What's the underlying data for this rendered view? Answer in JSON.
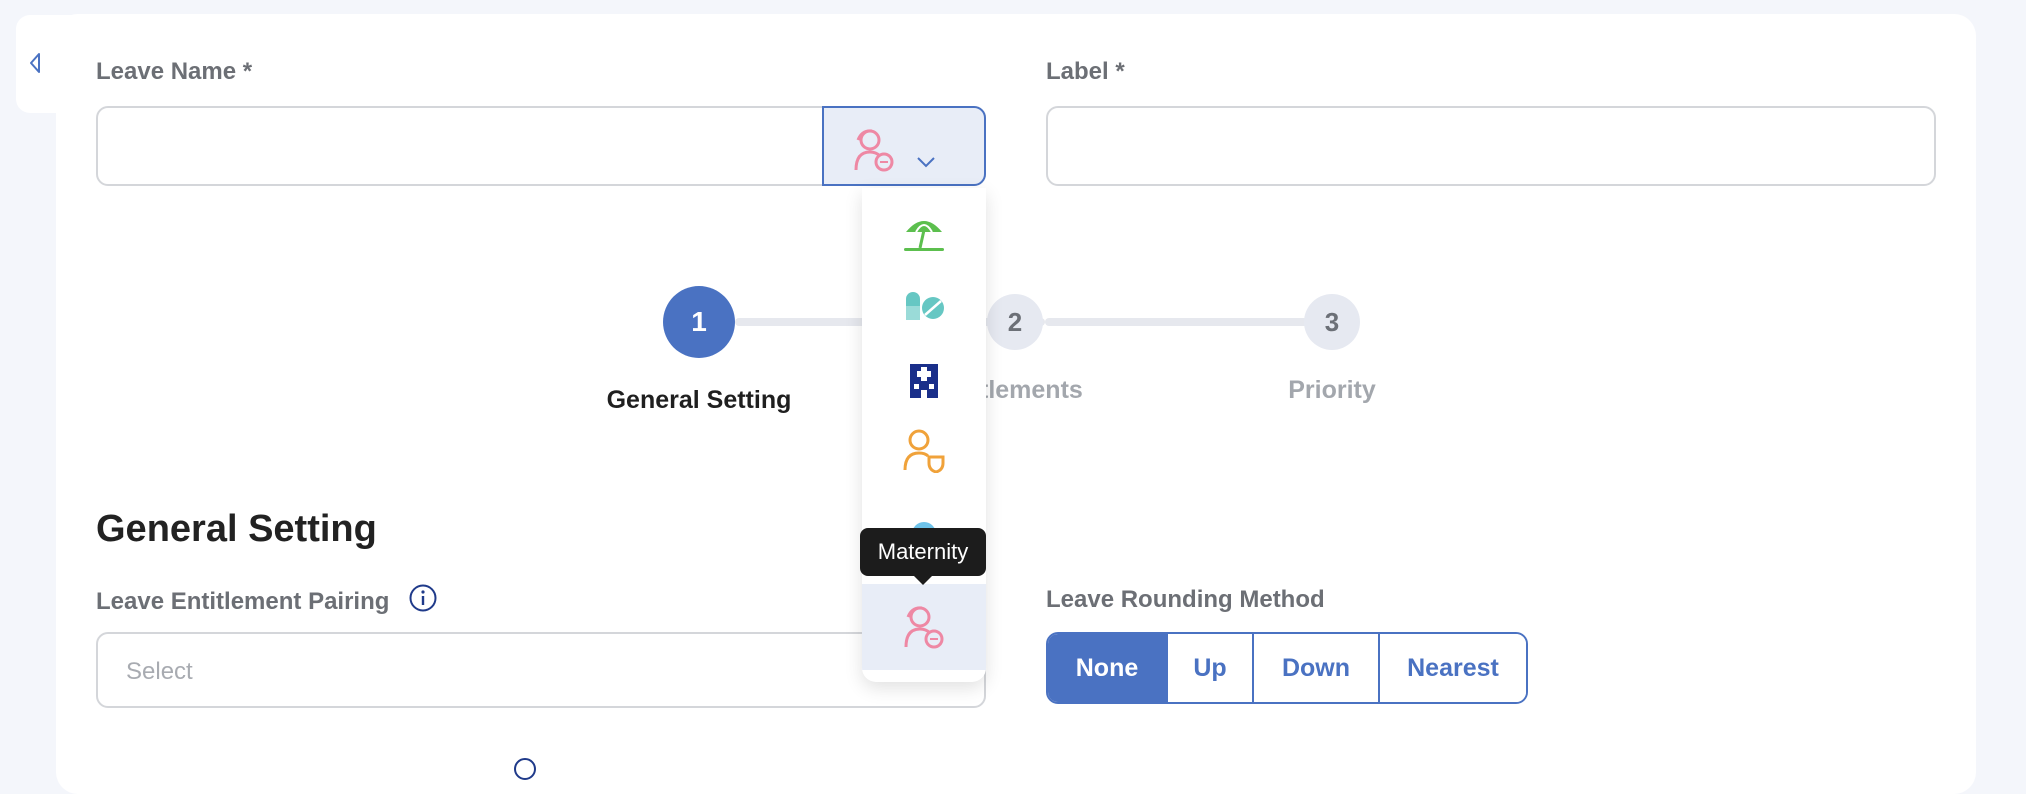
{
  "form": {
    "leave_name_label": "Leave Name",
    "label_label": "Label",
    "required_mark": "*",
    "leave_name_value": "",
    "label_value": ""
  },
  "icon_picker": {
    "selected_icon": "maternity-icon",
    "options": [
      {
        "icon": "beach-umbrella-icon",
        "color": "#5cbf4e"
      },
      {
        "icon": "pills-icon",
        "color": "#66c7c3"
      },
      {
        "icon": "hospital-icon",
        "color": "#1a2f8a"
      },
      {
        "icon": "person-shield-icon",
        "color": "#f0a23a"
      },
      {
        "icon": "blue-circle-icon",
        "color": "#6ec3ea"
      },
      {
        "icon": "maternity-icon",
        "color": "#ee88a4"
      }
    ],
    "tooltip": "Maternity"
  },
  "stepper": {
    "steps": [
      {
        "number": "1",
        "label": "General Setting",
        "state": "active"
      },
      {
        "number": "2",
        "label": "Entitlements",
        "state": "inactive",
        "visible_label": "tlements"
      },
      {
        "number": "3",
        "label": "Priority",
        "state": "inactive"
      }
    ]
  },
  "general_setting": {
    "title": "General Setting",
    "entitlement_pairing_label": "Leave Entitlement Pairing",
    "entitlement_pairing_placeholder": "Select",
    "rounding_label": "Leave Rounding Method",
    "rounding_options": [
      "None",
      "Up",
      "Down",
      "Nearest"
    ],
    "rounding_selected": "None"
  },
  "colors": {
    "accent": "#4a72c2",
    "maternity": "#ee88a4"
  }
}
